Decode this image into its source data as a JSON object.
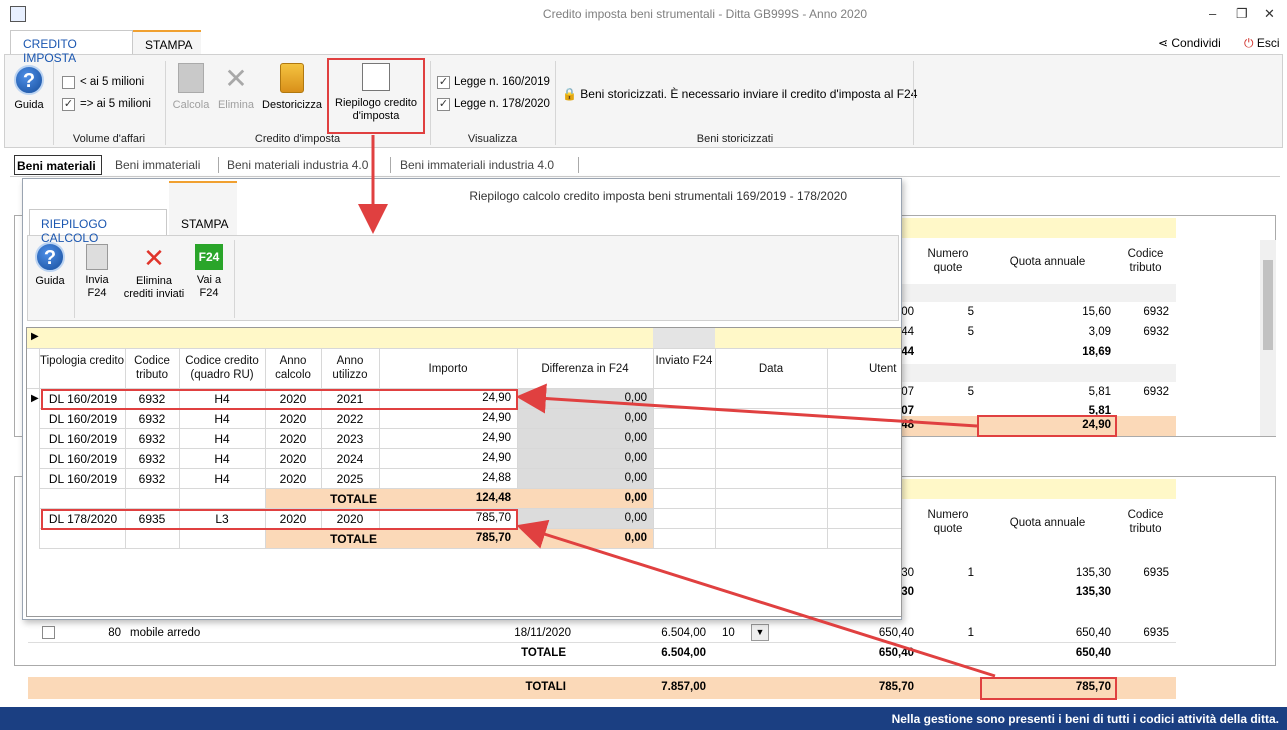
{
  "window": {
    "title": "Credito imposta beni strumentali - Ditta GB999S - Anno 2020",
    "minimize": "–",
    "restore": "❐",
    "close": "✕"
  },
  "tabs": [
    {
      "label": "CREDITO IMPOSTA"
    },
    {
      "label": "STAMPA"
    }
  ],
  "share": {
    "condividi": "Condividi",
    "esci": "Esci"
  },
  "ribbon": {
    "guida": "Guida",
    "volume": {
      "opt1": "< ai 5 milioni",
      "opt2": "=> ai 5 milioni",
      "group": "Volume d'affari"
    },
    "credito": {
      "calcola": "Calcola",
      "elimina": "Elimina",
      "destoricizza": "Destoricizza",
      "riepilogo1": "Riepilogo credito",
      "riepilogo2": "d'imposta",
      "group": "Credito d'imposta"
    },
    "vis": {
      "legge1": "Legge n. 160/2019",
      "legge2": "Legge n. 178/2020",
      "group": "Visualizza"
    },
    "storico": {
      "text": "Beni storicizzati. È necessario inviare il credito d'imposta al F24",
      "group": "Beni storicizzati"
    }
  },
  "subtabs": [
    "Beni materiali",
    "Beni immateriali",
    "Beni materiali industria 4.0",
    "Beni immateriali industria 4.0"
  ],
  "bg": {
    "headers": {
      "numero": "Numero quote",
      "quota": "Quota annuale",
      "codice": "Codice tributo"
    },
    "upper": [
      {
        "amt": "00",
        "n": "5",
        "q": "15,60",
        "c": "6932"
      },
      {
        "amt": "44",
        "n": "5",
        "q": "3,09",
        "c": "6932"
      },
      {
        "amt": "44",
        "n": "",
        "q": "18,69",
        "c": ""
      },
      {
        "amt": "07",
        "n": "5",
        "q": "5,81",
        "c": "6932"
      },
      {
        "amt": "07",
        "n": "",
        "q": "5,81",
        "c": ""
      },
      {
        "amt": "48",
        "n": "",
        "q": "24,90",
        "c": ""
      }
    ],
    "lower": [
      {
        "amt": "30",
        "n": "1",
        "q": "135,30",
        "c": "6935"
      },
      {
        "amt": "30",
        "n": "",
        "q": "135,30",
        "c": ""
      }
    ],
    "row80": {
      "num": "80",
      "desc": "mobile arredo",
      "date": "18/11/2020",
      "imp": "6.504,00",
      "perc": "10",
      "dep": "650,40",
      "n": "1",
      "q": "650,40",
      "c": "6935"
    },
    "totale": {
      "label": "TOTALE",
      "imp": "6.504,00",
      "dep": "650,40",
      "q": "650,40"
    },
    "totali": {
      "label": "TOTALI",
      "imp": "7.857,00",
      "dep": "785,70",
      "q": "785,70"
    }
  },
  "popup": {
    "title": "Riepilogo calcolo credito imposta beni strumentali 169/2019 - 178/2020",
    "tabs": [
      {
        "label": "RIEPILOGO CALCOLO"
      },
      {
        "label": "STAMPA"
      }
    ],
    "buttons": {
      "guida": "Guida",
      "invia1": "Invia",
      "invia2": "F24",
      "elimina1": "Elimina",
      "elimina2": "crediti inviati",
      "vai1": "Vai a",
      "vai2": "F24"
    },
    "columns": [
      "Tipologia credito",
      "Codice tributo",
      "Codice credito (quadro RU)",
      "Anno calcolo",
      "Anno utilizzo",
      "Importo",
      "Differenza in F24",
      "Inviato F24",
      "Data",
      "Utent"
    ],
    "rows": [
      {
        "tip": "DL 160/2019",
        "cod": "6932",
        "cc": "H4",
        "ac": "2020",
        "au": "2021",
        "imp": "24,90",
        "diff": "0,00"
      },
      {
        "tip": "DL 160/2019",
        "cod": "6932",
        "cc": "H4",
        "ac": "2020",
        "au": "2022",
        "imp": "24,90",
        "diff": "0,00"
      },
      {
        "tip": "DL 160/2019",
        "cod": "6932",
        "cc": "H4",
        "ac": "2020",
        "au": "2023",
        "imp": "24,90",
        "diff": "0,00"
      },
      {
        "tip": "DL 160/2019",
        "cod": "6932",
        "cc": "H4",
        "ac": "2020",
        "au": "2024",
        "imp": "24,90",
        "diff": "0,00"
      },
      {
        "tip": "DL 160/2019",
        "cod": "6932",
        "cc": "H4",
        "ac": "2020",
        "au": "2025",
        "imp": "24,88",
        "diff": "0,00"
      }
    ],
    "totale1": {
      "label": "TOTALE",
      "imp": "124,48",
      "diff": "0,00"
    },
    "row178": {
      "tip": "DL 178/2020",
      "cod": "6935",
      "cc": "L3",
      "ac": "2020",
      "au": "2020",
      "imp": "785,70",
      "diff": "0,00"
    },
    "totale2": {
      "label": "TOTALE",
      "imp": "785,70",
      "diff": "0,00"
    }
  },
  "status": "Nella gestione sono presenti i beni di tutti i codici attività della ditta.",
  "colors": {
    "accent": "#1a56b0",
    "highlight": "#e04040",
    "total_bg": "#fbd9b8",
    "status_bg": "#1b3f82"
  }
}
